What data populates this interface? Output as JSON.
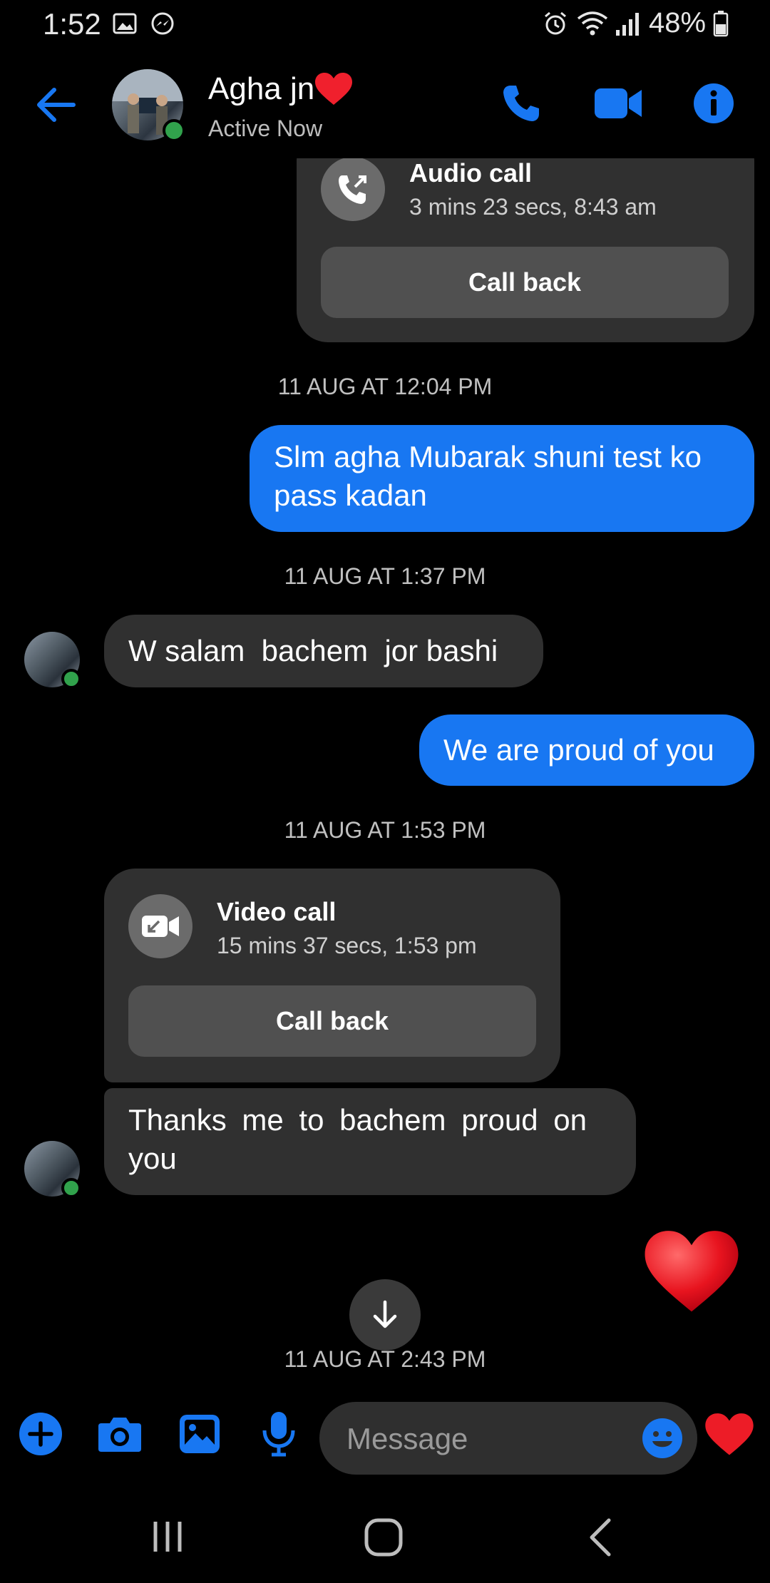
{
  "status_bar": {
    "time": "1:52",
    "battery": "48%"
  },
  "header": {
    "contact_name": "Agha jn",
    "contact_status": "Active Now",
    "back_icon": "back-arrow-icon",
    "call_icon": "phone-icon",
    "video_icon": "video-camera-icon",
    "info_icon": "info-icon",
    "accent_color": "#1877f2"
  },
  "messages": {
    "audio_call": {
      "title": "Audio call",
      "detail": "3 mins 23 secs, 8:43 am",
      "button": "Call back"
    },
    "ts1": "11 AUG AT 12:04 PM",
    "out1": "Slm agha Mubarak shuni test ko pass kadan",
    "ts2": "11 AUG AT 1:37 PM",
    "in1": "W salam  bachem  jor bashi",
    "out2": "We are proud of you",
    "ts3": "11 AUG AT 1:53 PM",
    "video_call": {
      "title": "Video call",
      "detail": "15 mins 37 secs, 1:53 pm",
      "button": "Call back"
    },
    "in2": "Thanks  me to  bachem  proud  on you",
    "ts4": "11 AUG AT 2:43 PM"
  },
  "composer": {
    "placeholder": "Message"
  }
}
